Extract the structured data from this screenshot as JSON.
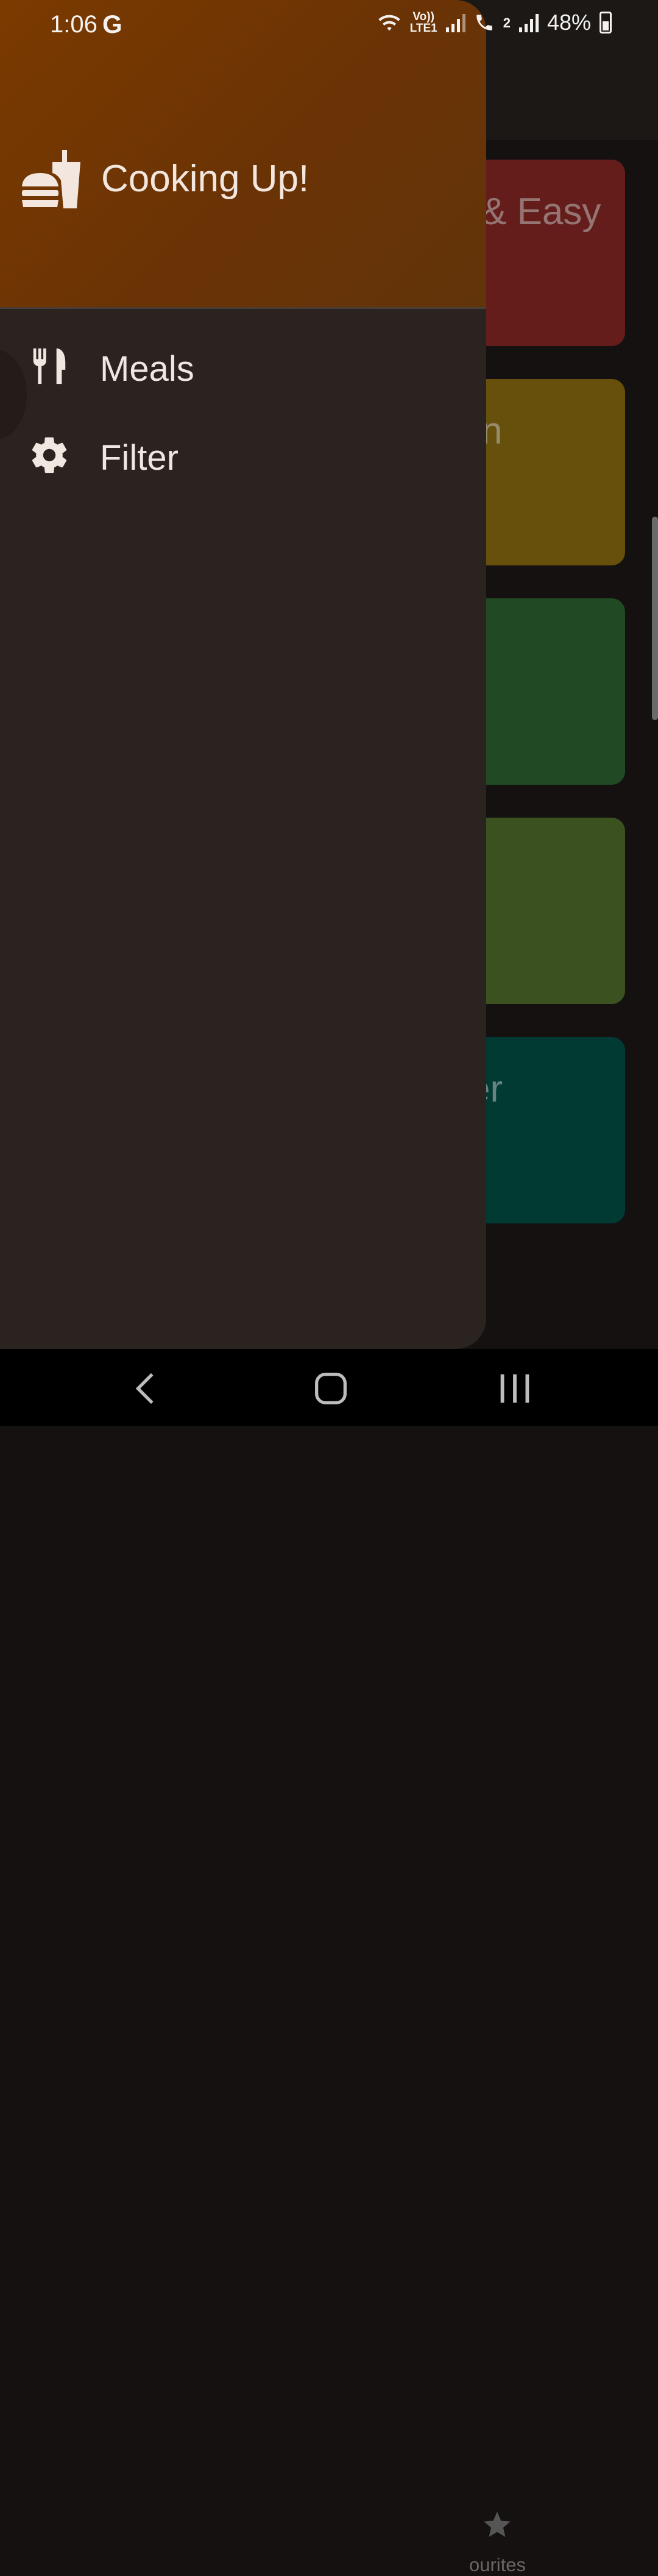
{
  "status_bar": {
    "time": "1:06",
    "google_indicator": "G",
    "volte_label_top": "Vo))",
    "volte_label_bottom": "LTE1",
    "sim2_label": "2",
    "battery_percent": "48%"
  },
  "drawer": {
    "app_title": "Cooking Up!",
    "items": [
      {
        "label": "Meals",
        "icon": "fork-knife-icon"
      },
      {
        "label": "Filter",
        "icon": "gear-icon"
      }
    ]
  },
  "background_app": {
    "cards": [
      {
        "label": "& Easy",
        "color": "#641d1a"
      },
      {
        "label": "n",
        "color": "#66500b"
      },
      {
        "label": "",
        "color": "#214a24"
      },
      {
        "label": "",
        "color": "#3b5120"
      },
      {
        "label": "er",
        "color": "#003a33"
      }
    ],
    "bottom_nav_label": "ourites"
  },
  "colors": {
    "accent": "#7b3a00",
    "drawer_bg": "#2b2320",
    "text_light": "#f1e7e1"
  }
}
